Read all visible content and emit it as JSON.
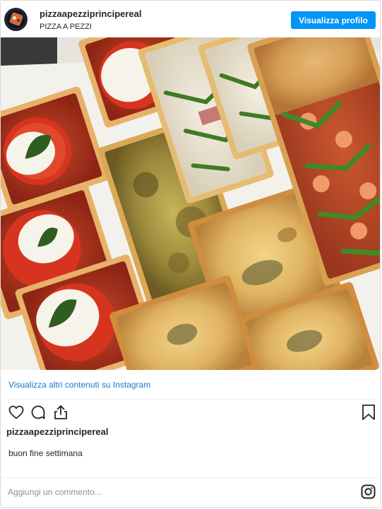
{
  "header": {
    "username": "pizzaapezziprincipereal",
    "subtitle": "PIZZA A PEZZI",
    "profile_button": "Visualizza profilo"
  },
  "post": {
    "photo_icon": "pizza-photo",
    "more_link": "Visualizza altri contenuti su Instagram",
    "caption_user": "pizzaapezziprincipereal",
    "caption_text": "buon fine settimana"
  },
  "actions": {
    "like_icon": "heart-icon",
    "comment_icon": "comment-icon",
    "share_icon": "share-icon",
    "save_icon": "bookmark-icon"
  },
  "comment": {
    "placeholder": "Aggiungi un commento...",
    "logo_icon": "instagram-icon"
  },
  "colors": {
    "accent": "#0095f6",
    "link": "#1778c9",
    "text": "#262626",
    "muted": "#8e8e8e"
  }
}
